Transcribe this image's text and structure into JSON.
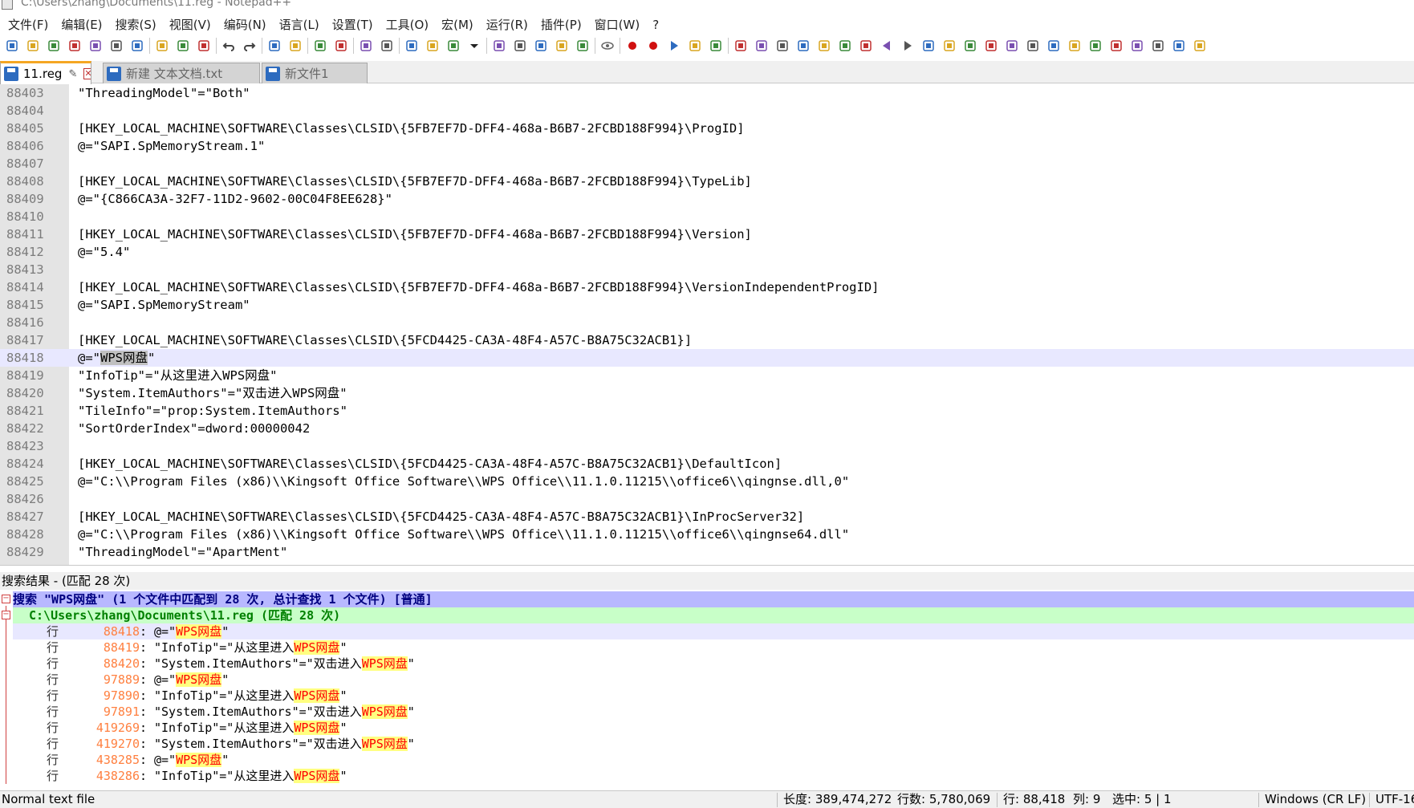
{
  "window": {
    "title": "C:\\Users\\zhang\\Documents\\11.reg - Notepad++"
  },
  "menu": [
    "文件(F)",
    "编辑(E)",
    "搜索(S)",
    "视图(V)",
    "编码(N)",
    "语言(L)",
    "设置(T)",
    "工具(O)",
    "宏(M)",
    "运行(R)",
    "插件(P)",
    "窗口(W)",
    "?"
  ],
  "toolbar": {
    "groups": [
      [
        "new-file-icon",
        "open-file-icon",
        "save-icon",
        "save-all-icon",
        "close-icon",
        "close-all-icon",
        "print-icon"
      ],
      [
        "cut-icon",
        "copy-icon",
        "paste-icon"
      ],
      [
        "undo-icon",
        "redo-icon"
      ],
      [
        "find-icon",
        "replace-icon"
      ],
      [
        "zoom-in-icon",
        "zoom-out-icon"
      ],
      [
        "sync-vertical-icon",
        "sync-horizontal-icon"
      ],
      [
        "word-wrap-icon",
        "show-all-chars-icon",
        "indent-guide-icon",
        "dropdown-icon"
      ],
      [
        "folder-as-workspace-icon",
        "function-list-icon",
        "document-map-icon",
        "udl-icon",
        "document-list-icon"
      ],
      [
        "monitoring-icon"
      ],
      [
        "record-macro-icon",
        "stop-record-icon",
        "play-macro-icon",
        "run-macro-multiple-icon",
        "save-macro-icon"
      ],
      [
        "plugin-1-icon",
        "plugin-2-icon",
        "plugin-3-icon",
        "plugin-4-icon",
        "plugin-5-icon",
        "plugin-6-icon",
        "first-bookmark-icon",
        "prev-bookmark-icon",
        "next-bookmark-icon",
        "last-bookmark-icon",
        "plugin-7-icon",
        "plugin-8-icon",
        "plugin-9-icon",
        "plugin-10-icon",
        "plugin-11-icon",
        "plugin-12-icon",
        "plugin-13-icon",
        "plugin-14-icon",
        "plugin-15-icon",
        "plugin-16-icon",
        "plugin-17-icon",
        "plugin-18-icon",
        "plugin-19-icon"
      ]
    ]
  },
  "tabs": [
    {
      "label": "11.reg",
      "active": true
    },
    {
      "label": "新建 文本文档.txt",
      "active": false
    },
    {
      "label": "新文件1",
      "active": false
    }
  ],
  "editor": {
    "current_line": "88418",
    "lines": [
      {
        "num": "88403",
        "text": "\"ThreadingModel\"=\"Both\""
      },
      {
        "num": "88404",
        "text": ""
      },
      {
        "num": "88405",
        "text": "[HKEY_LOCAL_MACHINE\\SOFTWARE\\Classes\\CLSID\\{5FB7EF7D-DFF4-468a-B6B7-2FCBD188F994}\\ProgID]"
      },
      {
        "num": "88406",
        "text": "@=\"SAPI.SpMemoryStream.1\""
      },
      {
        "num": "88407",
        "text": ""
      },
      {
        "num": "88408",
        "text": "[HKEY_LOCAL_MACHINE\\SOFTWARE\\Classes\\CLSID\\{5FB7EF7D-DFF4-468a-B6B7-2FCBD188F994}\\TypeLib]"
      },
      {
        "num": "88409",
        "text": "@=\"{C866CA3A-32F7-11D2-9602-00C04F8EE628}\""
      },
      {
        "num": "88410",
        "text": ""
      },
      {
        "num": "88411",
        "text": "[HKEY_LOCAL_MACHINE\\SOFTWARE\\Classes\\CLSID\\{5FB7EF7D-DFF4-468a-B6B7-2FCBD188F994}\\Version]"
      },
      {
        "num": "88412",
        "text": "@=\"5.4\""
      },
      {
        "num": "88413",
        "text": ""
      },
      {
        "num": "88414",
        "text": "[HKEY_LOCAL_MACHINE\\SOFTWARE\\Classes\\CLSID\\{5FB7EF7D-DFF4-468a-B6B7-2FCBD188F994}\\VersionIndependentProgID]"
      },
      {
        "num": "88415",
        "text": "@=\"SAPI.SpMemoryStream\""
      },
      {
        "num": "88416",
        "text": ""
      },
      {
        "num": "88417",
        "text": "[HKEY_LOCAL_MACHINE\\SOFTWARE\\Classes\\CLSID\\{5FCD4425-CA3A-48F4-A57C-B8A75C32ACB1}]"
      },
      {
        "num": "88418",
        "text": "@=\"WPS网盘\"",
        "selected": "WPS网盘"
      },
      {
        "num": "88419",
        "text": "\"InfoTip\"=\"从这里进入WPS网盘\""
      },
      {
        "num": "88420",
        "text": "\"System.ItemAuthors\"=\"双击进入WPS网盘\""
      },
      {
        "num": "88421",
        "text": "\"TileInfo\"=\"prop:System.ItemAuthors\""
      },
      {
        "num": "88422",
        "text": "\"SortOrderIndex\"=dword:00000042"
      },
      {
        "num": "88423",
        "text": ""
      },
      {
        "num": "88424",
        "text": "[HKEY_LOCAL_MACHINE\\SOFTWARE\\Classes\\CLSID\\{5FCD4425-CA3A-48F4-A57C-B8A75C32ACB1}\\DefaultIcon]"
      },
      {
        "num": "88425",
        "text": "@=\"C:\\\\Program Files (x86)\\\\Kingsoft Office Software\\\\WPS Office\\\\11.1.0.11215\\\\office6\\\\qingnse.dll,0\""
      },
      {
        "num": "88426",
        "text": ""
      },
      {
        "num": "88427",
        "text": "[HKEY_LOCAL_MACHINE\\SOFTWARE\\Classes\\CLSID\\{5FCD4425-CA3A-48F4-A57C-B8A75C32ACB1}\\InProcServer32]"
      },
      {
        "num": "88428",
        "text": "@=\"C:\\\\Program Files (x86)\\\\Kingsoft Office Software\\\\WPS Office\\\\11.1.0.11215\\\\office6\\\\qingnse64.dll\""
      },
      {
        "num": "88429",
        "text": "\"ThreadingModel\"=\"ApartMent\""
      }
    ]
  },
  "search_results": {
    "panel_title": "搜索结果 - (匹配 28 次)",
    "header": "搜索 \"WPS网盘\" (1 个文件中匹配到 28 次, 总计查找 1 个文件) [普通]",
    "file_header": "C:\\Users\\zhang\\Documents\\11.reg (匹配 28 次)",
    "term": "WPS网盘",
    "line_prefix": "行",
    "results": [
      {
        "line": "88418",
        "text": "@=\"WPS网盘\"",
        "current": true
      },
      {
        "line": "88419",
        "text": "\"InfoTip\"=\"从这里进入WPS网盘\""
      },
      {
        "line": "88420",
        "text": "\"System.ItemAuthors\"=\"双击进入WPS网盘\""
      },
      {
        "line": "97889",
        "text": "@=\"WPS网盘\""
      },
      {
        "line": "97890",
        "text": "\"InfoTip\"=\"从这里进入WPS网盘\""
      },
      {
        "line": "97891",
        "text": "\"System.ItemAuthors\"=\"双击进入WPS网盘\""
      },
      {
        "line": "419269",
        "text": "\"InfoTip\"=\"从这里进入WPS网盘\""
      },
      {
        "line": "419270",
        "text": "\"System.ItemAuthors\"=\"双击进入WPS网盘\""
      },
      {
        "line": "438285",
        "text": "@=\"WPS网盘\""
      },
      {
        "line": "438286",
        "text": "\"InfoTip\"=\"从这里进入WPS网盘\""
      }
    ]
  },
  "status": {
    "file_type": "Normal text file",
    "length": "长度: 389,474,272",
    "lines": "行数: 5,780,069",
    "position_line": "行: 88,418",
    "position_col": "列: 9",
    "selection": "选中: 5 | 1",
    "eol": "Windows (CR LF)",
    "encoding": "UTF-16"
  },
  "colors": {
    "search_header_bg": "#b8b8ff",
    "file_header_bg": "#c8ffc8",
    "current_line_bg": "#e8e8ff",
    "match_fg": "#ff0000",
    "match_bg": "#ffff80",
    "line_number_fg": "#ff8040",
    "active_tab_accent": "#f5a623"
  }
}
